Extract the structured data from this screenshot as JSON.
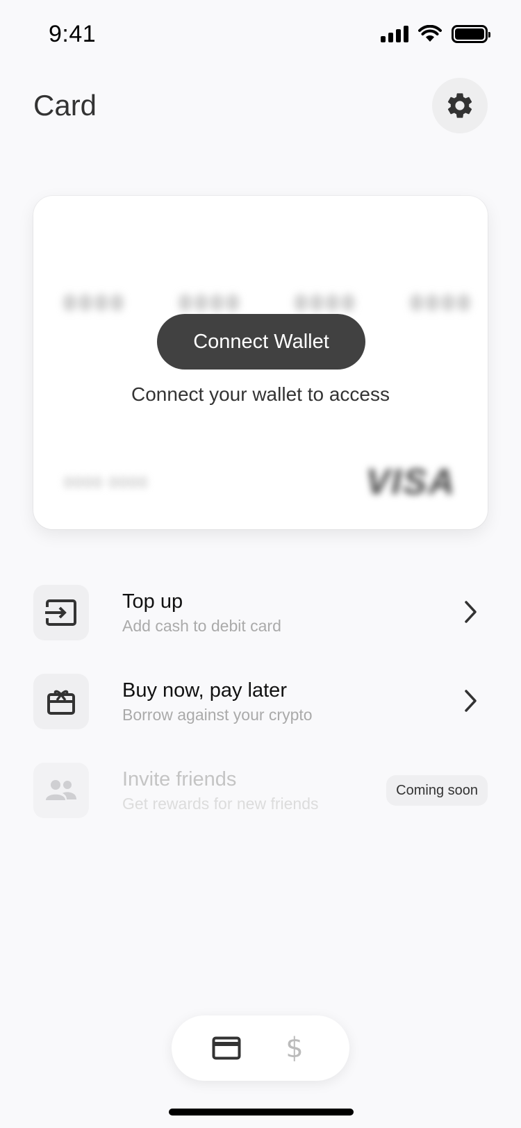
{
  "status_bar": {
    "time": "9:41"
  },
  "header": {
    "title": "Card",
    "settings_icon": "gear-icon"
  },
  "card": {
    "connect_button_label": "Connect Wallet",
    "subtitle": "Connect your wallet to access",
    "blurred_groups": [
      "0000",
      "0000",
      "0000",
      "0000"
    ],
    "blurred_expiry": "0000 0000",
    "blurred_brand": "VISA"
  },
  "actions": [
    {
      "title": "Top up",
      "subtitle": "Add cash to debit card",
      "icon": "transfer-in-icon",
      "enabled": true
    },
    {
      "title": "Buy now, pay later",
      "subtitle": "Borrow against your crypto",
      "icon": "gift-card-icon",
      "enabled": true
    },
    {
      "title": "Invite friends",
      "subtitle": "Get rewards for new friends",
      "icon": "people-icon",
      "enabled": false,
      "badge": "Coming soon"
    }
  ],
  "bottom_nav": {
    "tabs": [
      {
        "icon": "card-icon",
        "active": true
      },
      {
        "icon": "dollar-icon",
        "label": "$",
        "active": false
      }
    ]
  },
  "colors": {
    "background": "#f9f9fb",
    "primary_button": "#414141",
    "muted_text": "#aaaaaa"
  }
}
